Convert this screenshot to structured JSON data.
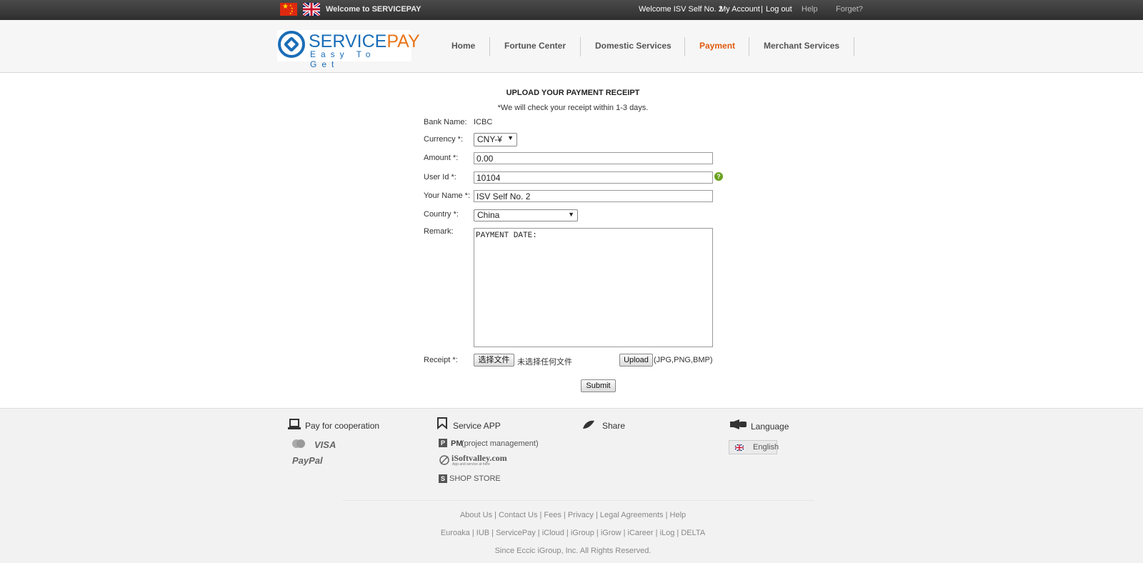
{
  "topbar": {
    "welcome_site": "Welcome to SERVICEPAY",
    "welcome_user": "Welcome ISV Self No. 2",
    "my_account": "My Account",
    "separator": "|",
    "logout": "Log out",
    "help": "Help",
    "forget": "Forget?"
  },
  "logo": {
    "name_part1": "SERVICE",
    "name_part2": "PAY",
    "tagline": "Easy To Get"
  },
  "nav": {
    "items": [
      {
        "label": "Home"
      },
      {
        "label": "Fortune Center"
      },
      {
        "label": "Domestic Services"
      },
      {
        "label": "Payment",
        "active": true
      },
      {
        "label": "Merchant Services"
      }
    ],
    "active_color": "#e05a0c"
  },
  "form": {
    "title": "UPLOAD YOUR PAYMENT RECEIPT",
    "note": "*We will check your receipt within 1-3 days.",
    "bank_label": "Bank Name:",
    "bank_value": "ICBC",
    "currency_label": "Currency *:",
    "currency_value": "CNY-¥",
    "amount_label": "Amount *:",
    "amount_value": "0.00",
    "userid_label": "User Id *:",
    "userid_value": "10104",
    "help_icon": "?",
    "name_label": "Your Name *:",
    "name_value": "ISV Self No. 2",
    "country_label": "Country *:",
    "country_value": "China",
    "remark_label": "Remark:",
    "remark_value": "PAYMENT DATE:",
    "receipt_label": "Receipt *:",
    "choose_file": "选择文件",
    "no_file": "未选择任何文件",
    "upload": "Upload",
    "formats": "(JPG,PNG,BMP)",
    "submit": "Submit"
  },
  "footer": {
    "pay_title": "Pay for cooperation",
    "visa": "VISA",
    "paypal": "PayPal",
    "app_title": "Service APP",
    "pm_bold": "PM",
    "pm_rest": "(project management)",
    "isoft": "iSoftvalley.com",
    "isoft_sub": "App and service at here",
    "shop": "SHOP STORE",
    "share_title": "Share",
    "lang_title": "Language",
    "lang_value": "English",
    "links1": "About Us | Contact Us | Fees | Privacy | Legal Agreements | Help",
    "links2": "Euroaka | IUB | ServicePay | iCloud | iGroup | iGrow | iCareer | iLog | DELTA",
    "copyright": "Since Eccic iGroup, Inc. All Rights Reserved."
  },
  "colors": {
    "brand_blue": "#1a6db8",
    "brand_orange": "#e8751a",
    "topbar_bg": "#3a3a3a",
    "help_green": "#6aa11e"
  }
}
